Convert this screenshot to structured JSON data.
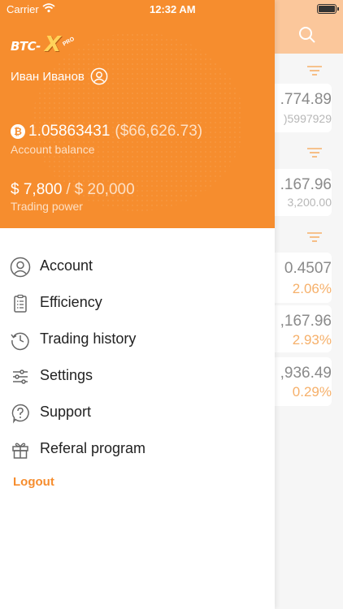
{
  "status_bar": {
    "carrier": "Carrier",
    "time": "12:32 AM"
  },
  "header": {
    "logo": "BTC-X PRO",
    "user_name": "Иван Иванов",
    "btc_balance": "1.05863431",
    "usd_balance": "($66,626.73)",
    "balance_label": "Account balance",
    "trading_power_value": "$ 7,800",
    "trading_power_separator": "/",
    "trading_power_max": "$ 20,000",
    "trading_power_label": "Trading power"
  },
  "menu": {
    "items": [
      {
        "label": "Account",
        "icon": "user-circle-icon"
      },
      {
        "label": "Efficiency",
        "icon": "clipboard-icon"
      },
      {
        "label": "Trading history",
        "icon": "history-clock-icon"
      },
      {
        "label": "Settings",
        "icon": "sliders-icon"
      },
      {
        "label": "Support",
        "icon": "question-icon"
      },
      {
        "label": "Referal program",
        "icon": "gift-icon"
      }
    ],
    "logout": "Logout"
  },
  "background": {
    "rows": [
      {
        "value": ".774.89",
        "sub": ")5997929"
      },
      {
        "value": ".167.96",
        "sub": "3,200.00"
      },
      {
        "value": "0.4507",
        "pct": "2.06%"
      },
      {
        "value": ",167.96",
        "pct": "2.93%"
      },
      {
        "value": ",936.49",
        "pct": "0.29%"
      }
    ]
  },
  "colors": {
    "accent": "#f68d2e",
    "accent_light": "#fbc79b",
    "text_dark": "#222222",
    "percent": "#f6b06a"
  }
}
